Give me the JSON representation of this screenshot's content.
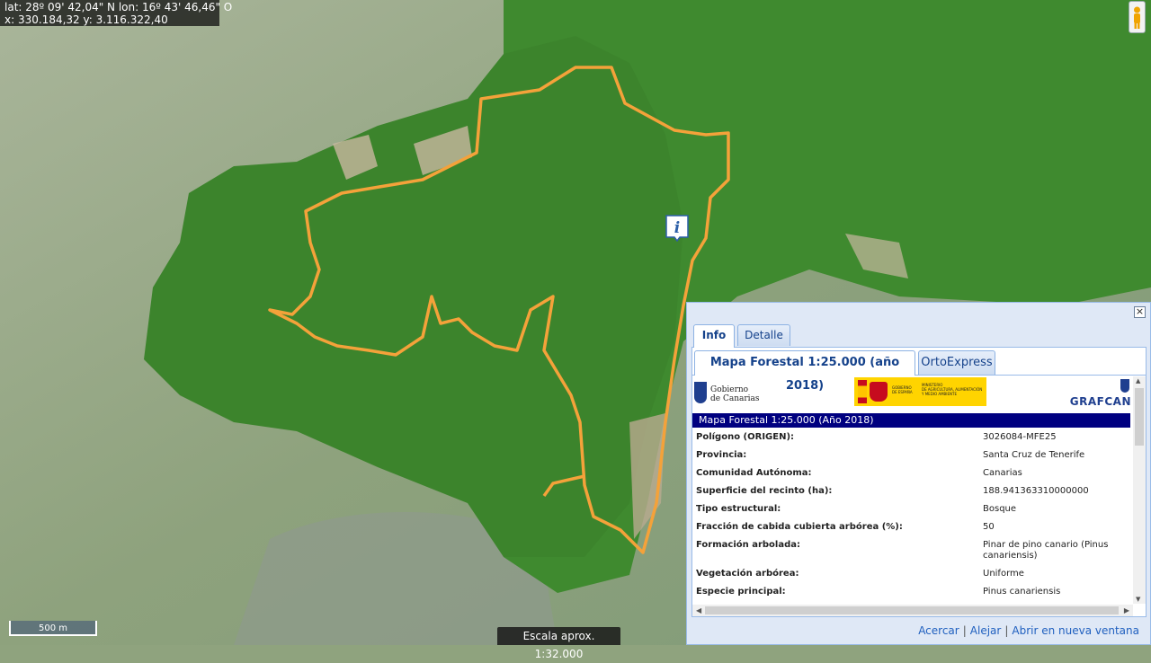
{
  "coordinates": {
    "latlon": "lat: 28º 09' 42,04\" N  lon: 16º 43' 46,46\" O",
    "xy": "x: 330.184,32  y: 3.116.322,40"
  },
  "scale_bar_label": "500 m",
  "scale_text": "Escala aprox. 1:32.000",
  "icons": {
    "street_view": "pegman-icon",
    "info_marker": "info-icon",
    "close": "close-icon"
  },
  "colors": {
    "forest": "#3f8a2f",
    "boundary": "#f4a23a",
    "terrain": "#8fa37e",
    "header_bar": "#000080"
  },
  "popup": {
    "close_label": "×",
    "tabs": [
      "Info",
      "Detalle"
    ],
    "subtabs": [
      "Mapa Forestal 1:25.000 (año 2018)",
      "OrtoExpress"
    ],
    "logos": {
      "gobierno": "Gobierno\nde Canarias",
      "gobierno_espana": "GOBIERNO\nDE ESPAÑA",
      "ministerio": "MINISTERIO\nDE AGRICULTURA, ALIMENTACIÓN\nY MEDIO AMBIENTE",
      "grafcan": "GRAFCAN"
    },
    "section_title": "Mapa Forestal 1:25.000 (Año 2018)",
    "rows": [
      {
        "key": "Polígono (ORIGEN):",
        "value": "3026084-MFE25"
      },
      {
        "key": "Provincia:",
        "value": "Santa Cruz de Tenerife"
      },
      {
        "key": "Comunidad Autónoma:",
        "value": "Canarias"
      },
      {
        "key": "Superficie del recinto (ha):",
        "value": "188.941363310000000"
      },
      {
        "key": "Tipo estructural:",
        "value": "Bosque"
      },
      {
        "key": "Fracción de cabida cubierta arbórea (%):",
        "value": "50"
      },
      {
        "key": "Formación arbolada:",
        "value": "Pinar de pino canario (Pinus canariensis)"
      },
      {
        "key": "Vegetación arbórea:",
        "value": "Uniforme"
      },
      {
        "key": "Especie principal:",
        "value": "Pinus canariensis"
      }
    ],
    "links": [
      "Acercar",
      "Alejar",
      "Abrir en nueva ventana"
    ]
  }
}
